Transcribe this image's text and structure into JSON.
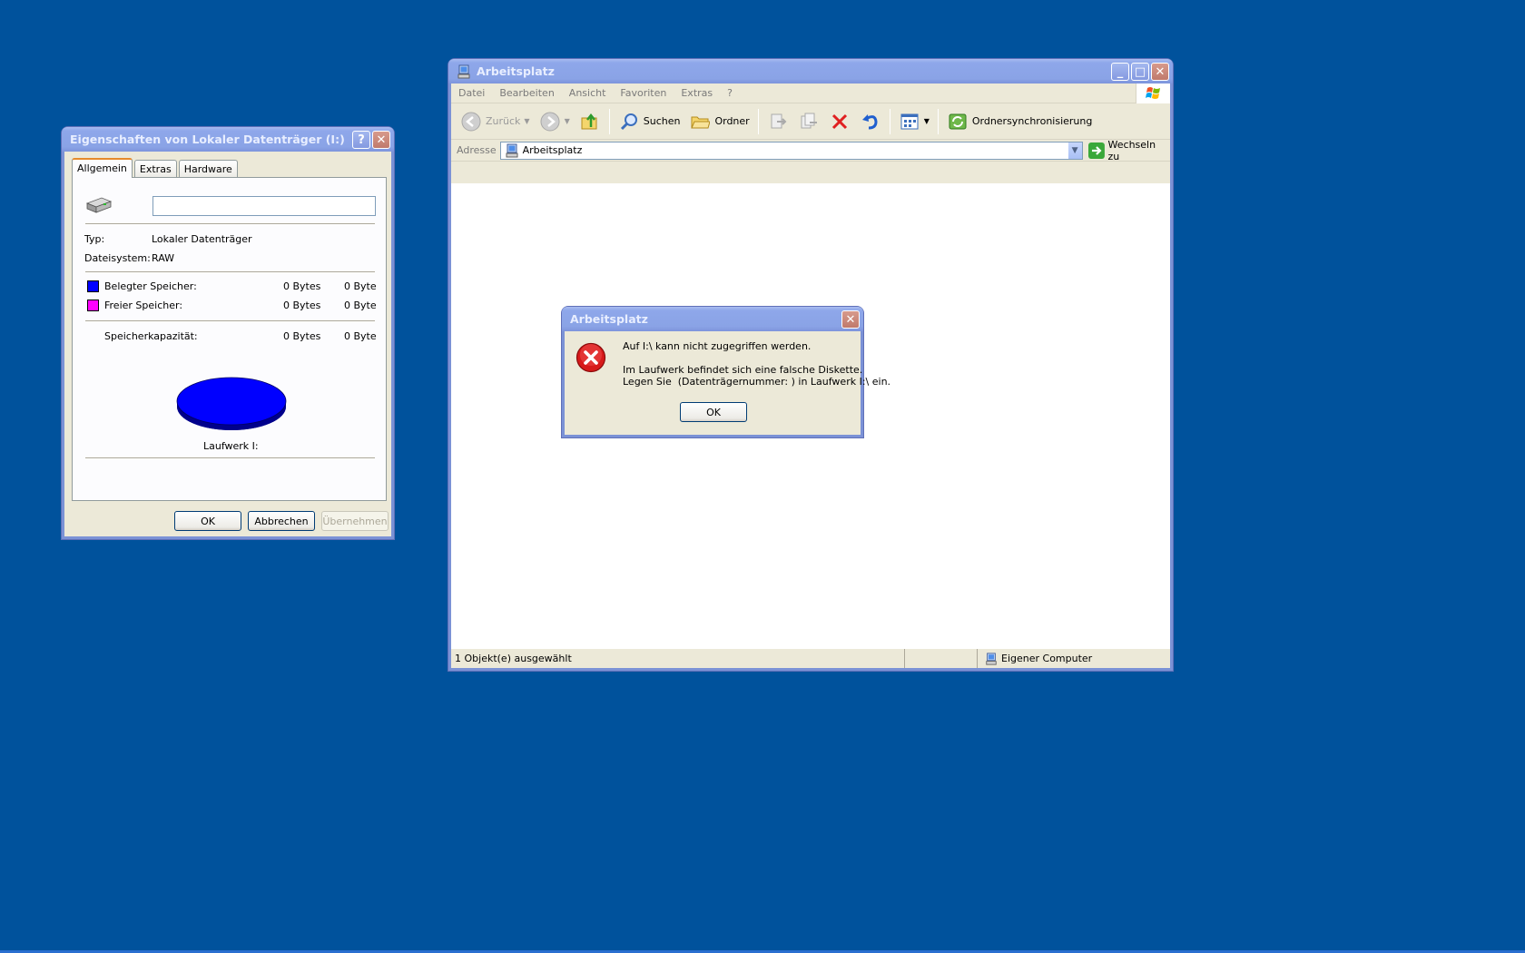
{
  "properties_dialog": {
    "title": "Eigenschaften von Lokaler Datenträger (I:)",
    "help_button": "?",
    "close_button": "✕",
    "tabs": [
      "Allgemein",
      "Extras",
      "Hardware"
    ],
    "selected_tab": "Allgemein",
    "drive_name_value": "",
    "type_label": "Typ:",
    "type_value": "Lokaler Datenträger",
    "fs_label": "Dateisystem:",
    "fs_value": "RAW",
    "used_label": "Belegter Speicher:",
    "used_bytes": "0 Bytes",
    "used_short": "0 Byte",
    "free_label": "Freier Speicher:",
    "free_bytes": "0 Bytes",
    "free_short": "0 Byte",
    "capacity_label": "Speicherkapazität:",
    "capacity_bytes": "0 Bytes",
    "capacity_short": "0 Byte",
    "drive_label": "Laufwerk I:",
    "ok_label": "OK",
    "cancel_label": "Abbrechen",
    "apply_label": "Übernehmen",
    "colors": {
      "used": "#0000ff",
      "free": "#ff00ff"
    }
  },
  "explorer": {
    "title": "Arbeitsplatz",
    "window_buttons": {
      "minimize": "_",
      "maximize": "□",
      "close": "✕"
    },
    "menu": [
      "Datei",
      "Bearbeiten",
      "Ansicht",
      "Favoriten",
      "Extras",
      "?"
    ],
    "toolbar": {
      "back": "Zurück",
      "search": "Suchen",
      "folders": "Ordner",
      "sync": "Ordnersynchronisierung"
    },
    "address_label": "Adresse",
    "address_value": "Arbeitsplatz",
    "go_label": "Wechseln zu",
    "status_left": "1 Objekt(e) ausgewählt",
    "status_right": "Eigener Computer"
  },
  "error_dialog": {
    "title": "Arbeitsplatz",
    "line1": "Auf I:\\ kann nicht zugegriffen werden.",
    "line2": "Im Laufwerk befindet sich eine falsche Diskette.",
    "line3": "Legen Sie  (Datenträgernummer: ) in Laufwerk I:\\ ein.",
    "ok_label": "OK"
  }
}
